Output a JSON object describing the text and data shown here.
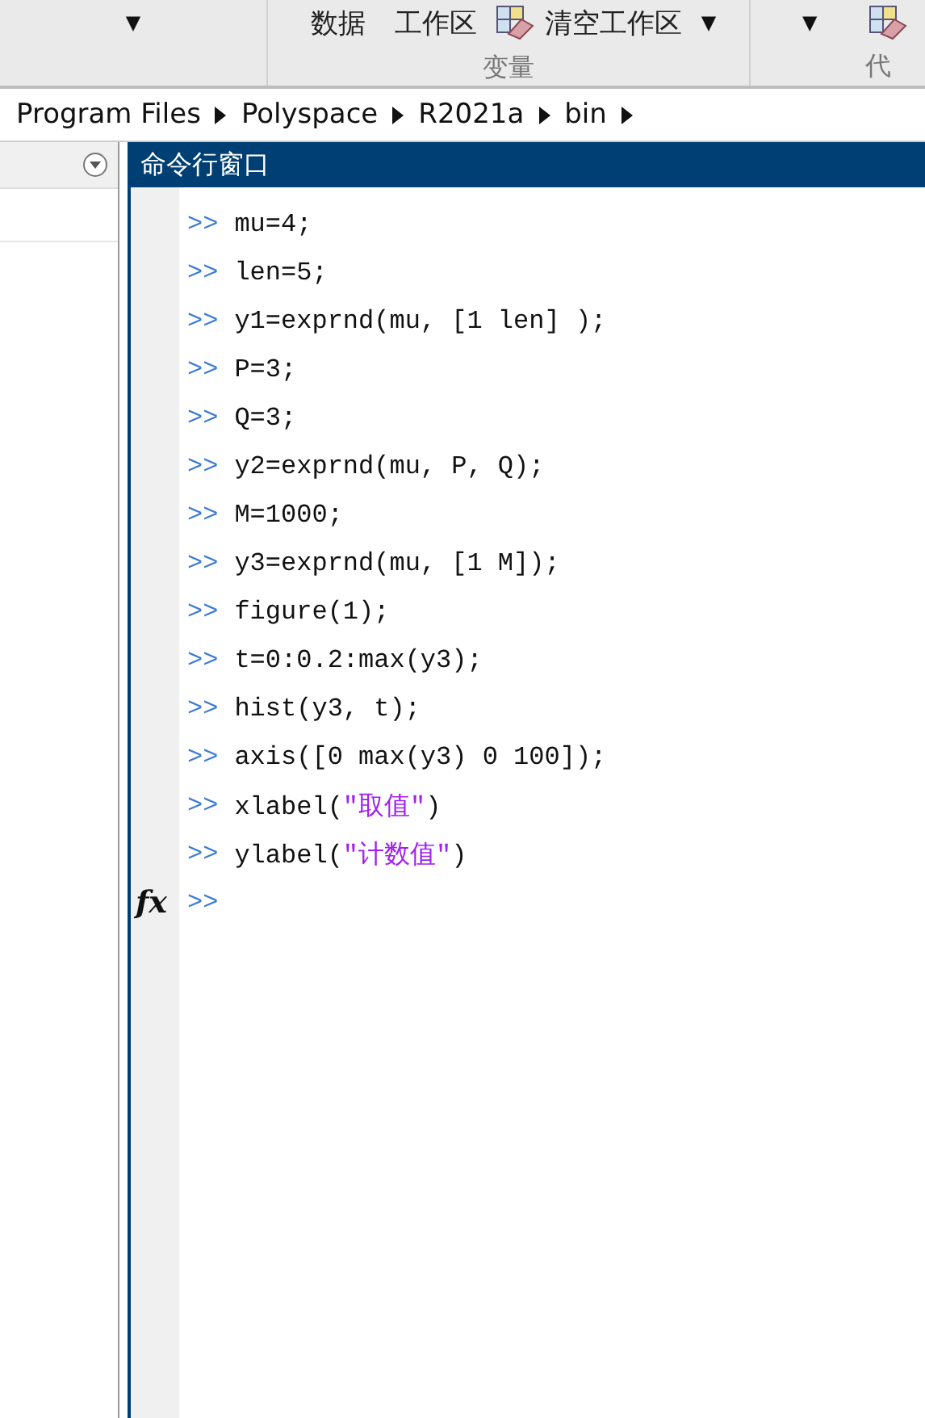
{
  "toolbar": {
    "dropdown_left": "▼",
    "items": [
      {
        "kind": "text",
        "label": "数据"
      },
      {
        "kind": "text",
        "label": "工作区"
      },
      {
        "kind": "icon-dropdown",
        "label": "清空工作区",
        "caret": "▼"
      }
    ],
    "group_label": "变量",
    "dropdown_right": "▼",
    "cut_label": "代"
  },
  "breadcrumb": [
    "Program Files",
    "Polyspace",
    "R2021a",
    "bin"
  ],
  "command_window": {
    "title": "命令行窗口",
    "prompt": ">>",
    "fx": "fx",
    "lines": [
      [
        {
          "kind": "code",
          "text": "mu=4;"
        }
      ],
      [
        {
          "kind": "code",
          "text": "len=5;"
        }
      ],
      [
        {
          "kind": "code",
          "text": "y1=exprnd(mu, [1 len] );"
        }
      ],
      [
        {
          "kind": "code",
          "text": "P=3;"
        }
      ],
      [
        {
          "kind": "code",
          "text": "Q=3;"
        }
      ],
      [
        {
          "kind": "code",
          "text": "y2=exprnd(mu, P, Q);"
        }
      ],
      [
        {
          "kind": "code",
          "text": "M=1000;"
        }
      ],
      [
        {
          "kind": "code",
          "text": "y3=exprnd(mu, [1 M]);"
        }
      ],
      [
        {
          "kind": "code",
          "text": "figure(1);"
        }
      ],
      [
        {
          "kind": "code",
          "text": "t=0:0.2:max(y3);"
        }
      ],
      [
        {
          "kind": "code",
          "text": "hist(y3, t);"
        }
      ],
      [
        {
          "kind": "code",
          "text": "axis([0 max(y3) 0 100]);"
        }
      ],
      [
        {
          "kind": "code",
          "text": "xlabel("
        },
        {
          "kind": "string",
          "text": "\"取值\""
        },
        {
          "kind": "code",
          "text": ")"
        }
      ],
      [
        {
          "kind": "code",
          "text": "ylabel("
        },
        {
          "kind": "string",
          "text": "\"计数值\""
        },
        {
          "kind": "code",
          "text": ")"
        }
      ]
    ]
  }
}
